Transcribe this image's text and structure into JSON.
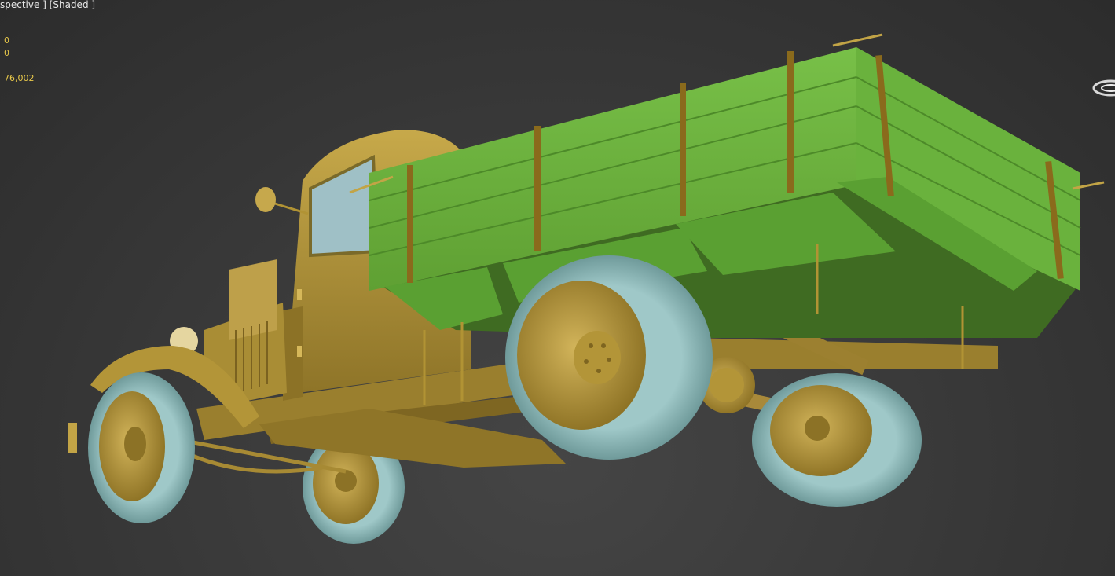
{
  "viewport": {
    "label": "spective ] [Shaded ]",
    "background_color": "#3a3a3a"
  },
  "statistics": {
    "value_a": "0",
    "value_b": "0",
    "value_c": "76,002",
    "text_color": "#e8c84a"
  },
  "scene": {
    "subject": "truck-model",
    "colors": {
      "body": "#b89a3e",
      "bed": "#6db33f",
      "tires": "#8fb8b8"
    }
  },
  "icons": {
    "view_gizmo": "viewcube-ring-icon"
  }
}
